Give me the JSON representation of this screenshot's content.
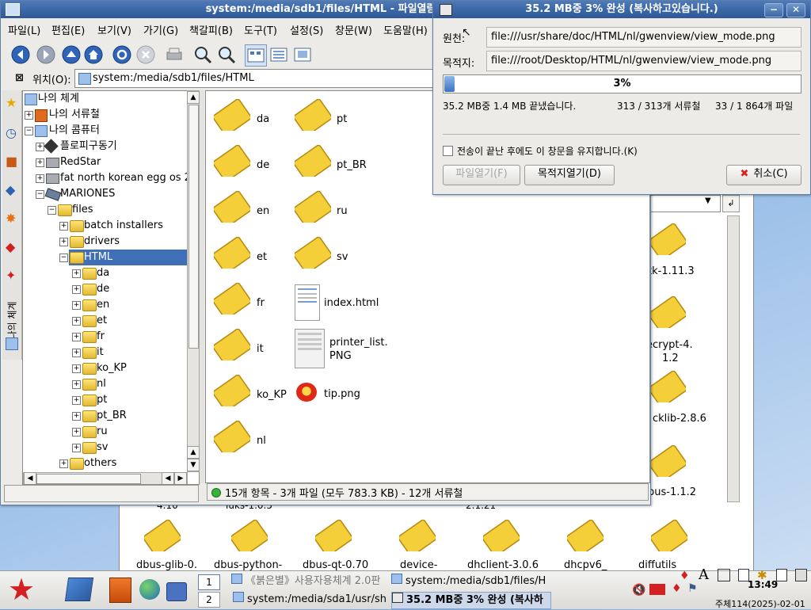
{
  "file_manager": {
    "title": "system:/media/sdb1/files/HTML - 파일열람기",
    "menu": [
      "파일(L)",
      "편집(E)",
      "보기(V)",
      "가기(G)",
      "책갈피(B)",
      "도구(T)",
      "설정(S)",
      "창문(W)",
      "도움말(H)"
    ],
    "location_label": "위치(O):",
    "location_value": "system:/media/sdb1/files/HTML",
    "tree": [
      {
        "label": "나의 체계",
        "depth": 0
      },
      {
        "label": "나의 서류철",
        "depth": 0
      },
      {
        "label": "나의 콤퓨터",
        "depth": 0
      },
      {
        "label": "플로피구동기",
        "depth": 1
      },
      {
        "label": "RedStar",
        "depth": 1
      },
      {
        "label": "fat north korean egg os 2",
        "depth": 1
      },
      {
        "label": "MARIONES",
        "depth": 1
      },
      {
        "label": "files",
        "depth": 2
      },
      {
        "label": "batch installers",
        "depth": 3
      },
      {
        "label": "drivers",
        "depth": 3
      },
      {
        "label": "HTML",
        "depth": 3
      },
      {
        "label": "da",
        "depth": 4
      },
      {
        "label": "de",
        "depth": 4
      },
      {
        "label": "en",
        "depth": 4
      },
      {
        "label": "et",
        "depth": 4
      },
      {
        "label": "fr",
        "depth": 4
      },
      {
        "label": "it",
        "depth": 4
      },
      {
        "label": "ko_KP",
        "depth": 4
      },
      {
        "label": "nl",
        "depth": 4
      },
      {
        "label": "pt",
        "depth": 4
      },
      {
        "label": "pt_BR",
        "depth": 4
      },
      {
        "label": "ru",
        "depth": 4
      },
      {
        "label": "sv",
        "depth": 4
      },
      {
        "label": "others",
        "depth": 3
      }
    ],
    "side_tab_label": "나의 체계",
    "items_col1": [
      "da",
      "de",
      "en",
      "et",
      "fr",
      "it",
      "ko_KP",
      "nl"
    ],
    "items_col2": [
      "pt",
      "pt_BR",
      "ru",
      "sv"
    ],
    "file_index": "index.html",
    "file_printer_1": "printer_list.",
    "file_printer_2": "PNG",
    "file_tip": "tip.png",
    "status": "15개 항목 - 3개 파일 (모두 783.3 KB) - 12개 서류철"
  },
  "copy_dialog": {
    "title": "35.2 MB중 3% 완성 (복사하고있습니다.)",
    "source_label": "원천:",
    "source_value": "file:///usr/share/doc/HTML/nl/gwenview/view_mode.png",
    "dest_label": "목적지:",
    "dest_value": "file:///root/Desktop/HTML/nl/gwenview/view_mode.png",
    "progress": 3,
    "progress_text": "3%",
    "bytes_text": "35.2 MB중 1.4 MB 끝냈습니다.",
    "folders_text": "313 / 313개 서류철",
    "files_text": "33 / 1 864개 파일",
    "keep_open_label": "전송이 끝난 후에도 이 창문을 유지합니다.(K)",
    "open_file_button": "파일열기(F)",
    "open_dest_button": "목적지열기(D)",
    "cancel_button": "취소(C)"
  },
  "background_window": {
    "right_items": [
      "tk-1.11.3",
      "ecrypt-4.",
      "1.2",
      "cklib-2.8.6",
      "bus-1.1.2"
    ],
    "bottom_partial": [
      "4.10",
      "luks-1.0.5",
      "2.1.21"
    ],
    "bottom_items": [
      "dbus-glib-0.",
      "dbus-python-",
      "dbus-qt-0.70",
      "device-",
      "dhclient-3.0.6",
      "dhcpv6_",
      "diffutils"
    ]
  },
  "taskbar": {
    "desktop_1": "1",
    "desktop_2": "2",
    "tasks": [
      "《붉은별》사용자용체계 2.0판",
      "system:/media/sdb1/files/H",
      "system:/media/sda1/usr/sh",
      "35.2 MB중 3% 완성 (복사하"
    ],
    "clock_time": "13:49",
    "clock_date": "주체114(2025)-02-01"
  }
}
